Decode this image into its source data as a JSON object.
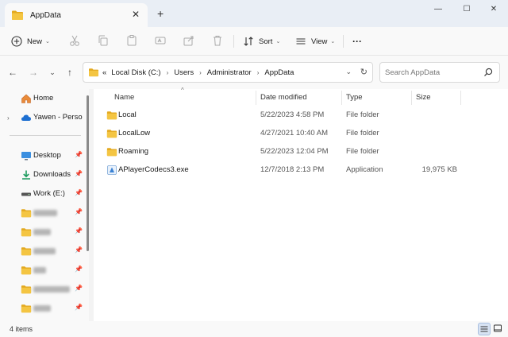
{
  "window": {
    "tab_title": "AppData",
    "new_tab_symbol": "+",
    "close_tab_symbol": "✕",
    "minimize_symbol": "—",
    "maximize_symbol": "☐",
    "close_symbol": "✕"
  },
  "toolbar": {
    "new_label": "New",
    "sort_label": "Sort",
    "view_label": "View",
    "more_label": "···"
  },
  "address": {
    "chevron": "«",
    "crumbs": [
      "Local Disk (C:)",
      "Users",
      "Administrator",
      "AppData"
    ],
    "search_placeholder": "Search AppData"
  },
  "sidebar": {
    "items": [
      {
        "label": "Home",
        "icon": "home-icon"
      },
      {
        "label": "Yawen - Persona",
        "icon": "cloud-icon"
      },
      {
        "label": "Desktop",
        "icon": "desktop-icon"
      },
      {
        "label": "Downloads",
        "icon": "download-icon"
      },
      {
        "label": "Work (E:)",
        "icon": "drive-icon"
      }
    ],
    "blurred_folders": 5
  },
  "columns": {
    "name": "Name",
    "date": "Date modified",
    "type": "Type",
    "size": "Size"
  },
  "files": [
    {
      "name": "Local",
      "date": "5/22/2023 4:58 PM",
      "type": "File folder",
      "size": "",
      "icon": "folder-icon"
    },
    {
      "name": "LocalLow",
      "date": "4/27/2021 10:40 AM",
      "type": "File folder",
      "size": "",
      "icon": "folder-icon"
    },
    {
      "name": "Roaming",
      "date": "5/22/2023 12:04 PM",
      "type": "File folder",
      "size": "",
      "icon": "folder-icon"
    },
    {
      "name": "APlayerCodecs3.exe",
      "date": "12/7/2018 2:13 PM",
      "type": "Application",
      "size": "19,975 KB",
      "icon": "exe-icon"
    }
  ],
  "status": {
    "item_count": "4 items"
  },
  "colors": {
    "folder": "#f4c542",
    "folder_dark": "#e3a920",
    "accent": "#0067c0"
  }
}
